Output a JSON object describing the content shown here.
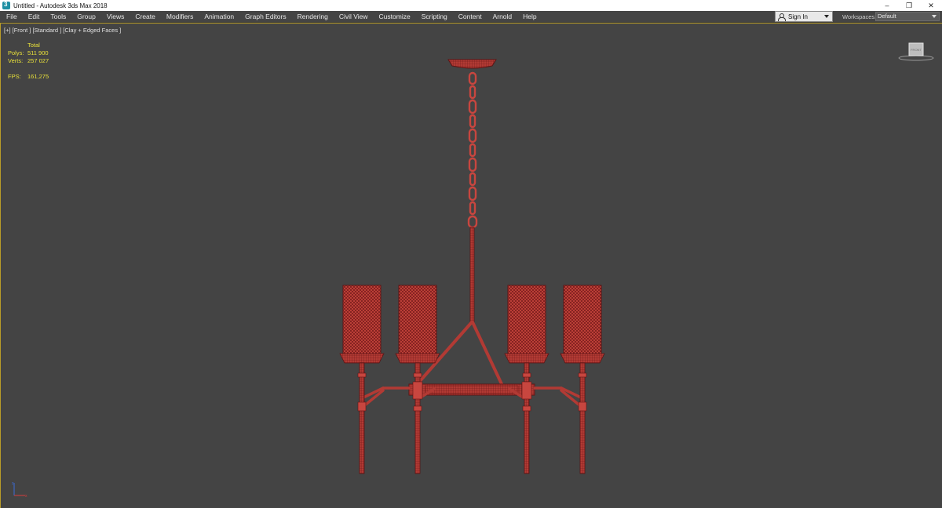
{
  "window": {
    "title": "Untitled - Autodesk 3ds Max 2018",
    "controls": {
      "minimize": "–",
      "restore": "❐",
      "close": "✕"
    }
  },
  "menu": {
    "items": [
      "File",
      "Edit",
      "Tools",
      "Group",
      "Views",
      "Create",
      "Modifiers",
      "Animation",
      "Graph Editors",
      "Rendering",
      "Civil View",
      "Customize",
      "Scripting",
      "Content",
      "Arnold",
      "Help"
    ]
  },
  "account": {
    "sign_in": "Sign In"
  },
  "workspaces": {
    "label": "Workspaces:",
    "value": "Default"
  },
  "viewport": {
    "label": "[+] [Front ] [Standard ] [Clay + Edged Faces ]",
    "stats": {
      "header": "Total",
      "polys_label": "Polys:",
      "polys_value": "511 900",
      "verts_label": "Verts:",
      "verts_value": "257 027",
      "fps_label": "FPS:",
      "fps_value": "161,275"
    },
    "viewcube_label": "FRONT"
  },
  "colors": {
    "viewport_bg": "#444444",
    "active_border": "#b89c28",
    "stats_text": "#e8e03a",
    "wire": "#8a1e1e",
    "model": "#c8463f"
  }
}
